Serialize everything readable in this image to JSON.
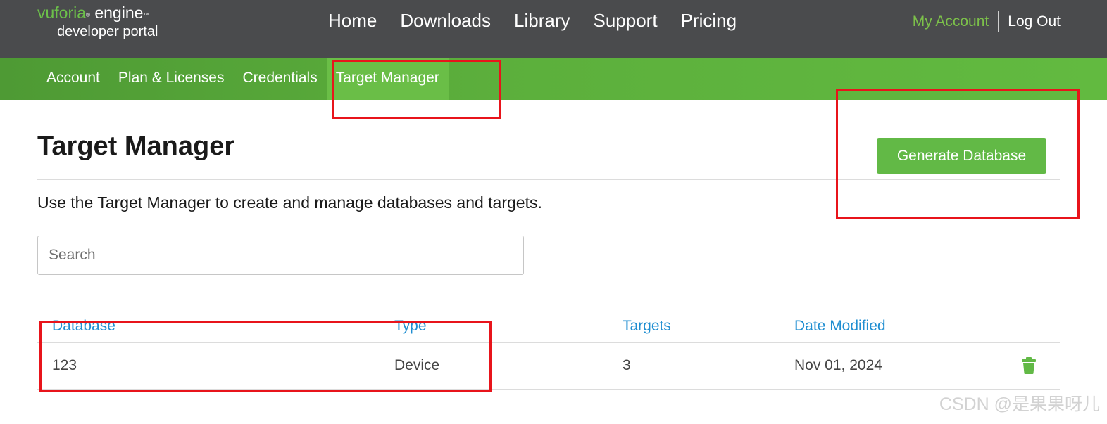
{
  "header": {
    "logo_brand": "vuforia",
    "logo_reg": "®",
    "logo_engine": "engine",
    "logo_tm": "™",
    "logo_sub": "developer portal",
    "nav": [
      "Home",
      "Downloads",
      "Library",
      "Support",
      "Pricing"
    ],
    "my_account": "My Account",
    "log_out": "Log Out"
  },
  "subnav": {
    "items": [
      "Account",
      "Plan & Licenses",
      "Credentials",
      "Target Manager"
    ],
    "active": "Target Manager"
  },
  "main": {
    "title": "Target Manager",
    "generate_button": "Generate Database",
    "intro": "Use the Target Manager to create and manage databases and targets.",
    "search_placeholder": "Search"
  },
  "table": {
    "headers": [
      "Database",
      "Type",
      "Targets",
      "Date Modified"
    ],
    "rows": [
      {
        "database": "123",
        "type": "Device",
        "targets": "3",
        "date_modified": "Nov 01, 2024",
        "action_icon": "trash-icon"
      }
    ]
  },
  "colors": {
    "header_bg": "#4a4b4d",
    "brand_green": "#62b946",
    "link_blue": "#1f8ed1",
    "annotation_red": "#e8141b"
  },
  "watermark": "CSDN @是果果呀儿"
}
